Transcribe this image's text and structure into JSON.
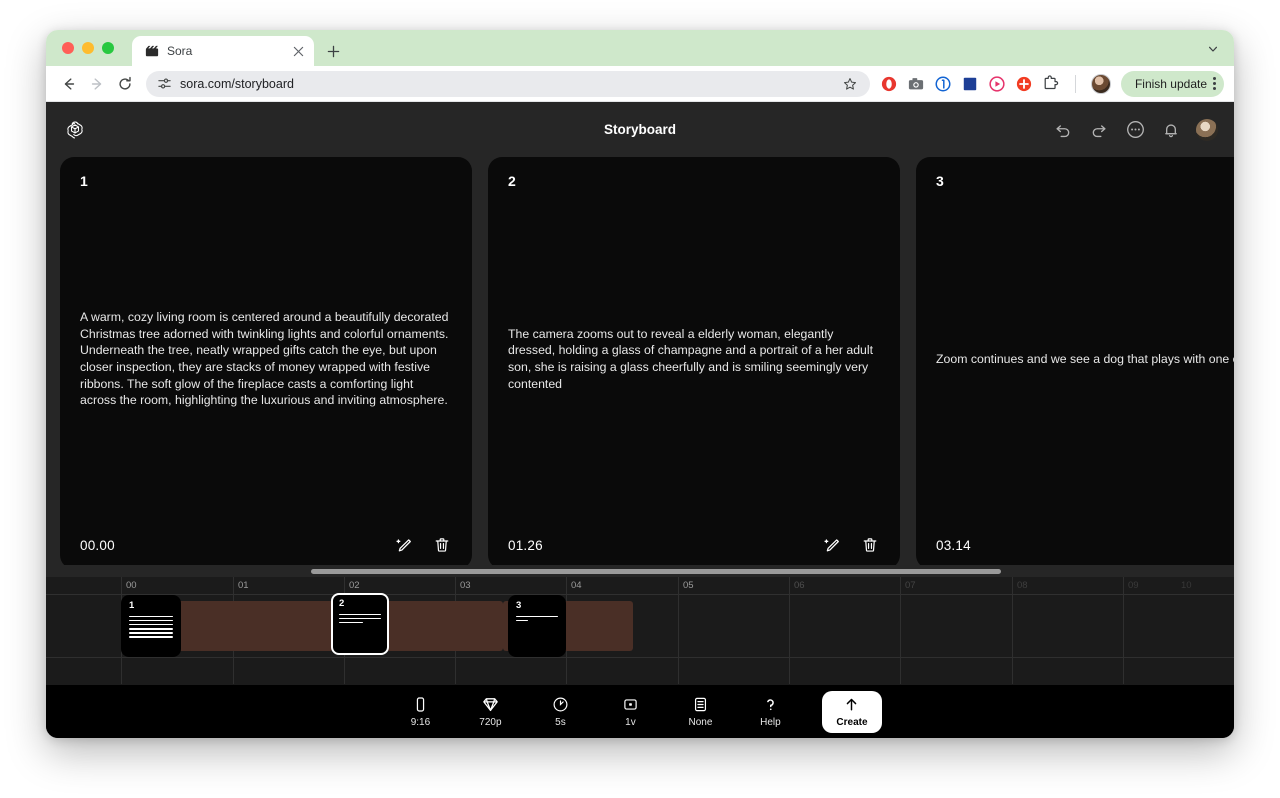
{
  "browser": {
    "tab": {
      "title": "Sora",
      "favicon": "clapperboard-icon"
    },
    "new_tab_label": "+",
    "url": "sora.com/storyboard",
    "nav": {
      "back": "back-arrow",
      "forward": "forward-arrow",
      "reload": "reload"
    },
    "finish_update_label": "Finish update",
    "extensions": [
      {
        "name": "opera-extension-icon",
        "color": "#e8372f"
      },
      {
        "name": "camera-extension-icon",
        "color": "#5f6368"
      },
      {
        "name": "one-password-extension-icon",
        "color": "#1264d3"
      },
      {
        "name": "blue-square-extension-icon",
        "color": "#1d3f96"
      },
      {
        "name": "video-record-extension-icon",
        "color": "#e6336b"
      },
      {
        "name": "plus-circle-extension-icon",
        "color": "#f23c22"
      },
      {
        "name": "puzzle-extensions-icon",
        "color": "#3c4043"
      }
    ]
  },
  "app": {
    "logo": "openai-logo",
    "title": "Storyboard",
    "header_actions": [
      {
        "name": "undo-button",
        "icon": "undo-icon"
      },
      {
        "name": "redo-button",
        "icon": "redo-icon"
      },
      {
        "name": "more-options-button",
        "icon": "ellipsis-circle-icon"
      },
      {
        "name": "notifications-button",
        "icon": "bell-icon"
      },
      {
        "name": "account-avatar",
        "icon": "avatar"
      }
    ],
    "cards": [
      {
        "number": "1",
        "text": "A warm, cozy living room is centered around a beautifully decorated Christmas tree adorned with twinkling lights and colorful ornaments. Underneath the tree, neatly wrapped gifts catch the eye, but upon closer inspection, they are stacks of money wrapped with festive ribbons. The soft glow of the fireplace casts a comforting light across the room, highlighting the luxurious and inviting atmosphere.",
        "time": "00.00",
        "edit_icon": "magic-pencil-icon",
        "delete_icon": "trash-icon"
      },
      {
        "number": "2",
        "text": "The camera zooms out to reveal a elderly woman, elegantly dressed, holding a glass of champagne and a portrait of a her adult son, she is raising a glass cheerfully and is smiling seemingly very contented",
        "time": "01.26",
        "edit_icon": "magic-pencil-icon",
        "delete_icon": "trash-icon"
      },
      {
        "number": "3",
        "text": "Zoom continues and we see a dog that plays with one of ",
        "time": "03.14",
        "edit_icon": "magic-pencil-icon",
        "delete_icon": "trash-icon"
      }
    ],
    "timeline": {
      "ruler_labels": [
        "00",
        "01",
        "02",
        "03",
        "04",
        "05",
        "06",
        "07",
        "08",
        "09",
        "10"
      ],
      "clips": [
        {
          "number": "1",
          "lines": 6,
          "selected": false
        },
        {
          "number": "2",
          "lines": 3,
          "selected": true
        },
        {
          "number": "3",
          "lines": 2,
          "selected": false
        }
      ]
    },
    "bottom_bar": [
      {
        "label": "9:16",
        "icon": "aspect-ratio-phone-icon"
      },
      {
        "label": "720p",
        "icon": "resolution-diamond-icon"
      },
      {
        "label": "5s",
        "icon": "duration-clock-icon"
      },
      {
        "label": "1v",
        "icon": "variations-icon"
      },
      {
        "label": "None",
        "icon": "storyboard-preset-icon"
      },
      {
        "label": "Help",
        "icon": "question-mark-icon"
      },
      {
        "label": "Create",
        "icon": "arrow-up-icon"
      }
    ]
  },
  "colors": {
    "accent_green": "#cfe8cb",
    "app_bg": "#262626",
    "card_bg": "#0a0a0a",
    "clip_band": "#4a2f26"
  }
}
